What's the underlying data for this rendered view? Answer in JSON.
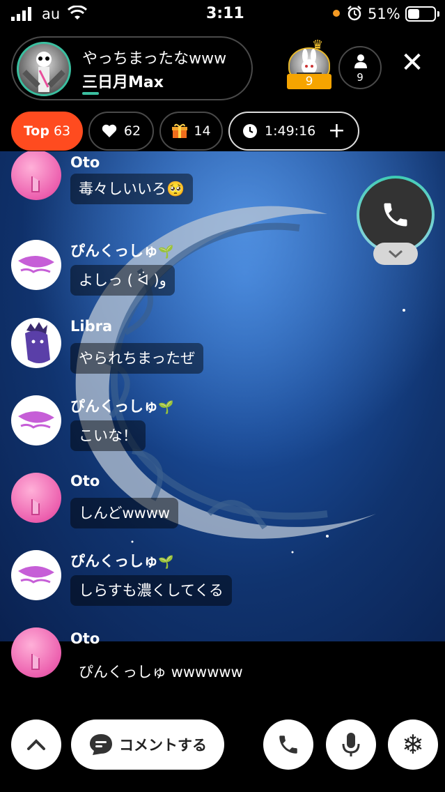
{
  "status_bar": {
    "carrier": "au",
    "time": "3:11",
    "battery_percent": "51%",
    "battery_level": 0.51
  },
  "header": {
    "stream_title": "やっちまったなwww",
    "host_name": "三日月Max",
    "top_ranker_badge": "9",
    "viewer_count": "9",
    "close_label": "✕"
  },
  "stats": {
    "top_label": "Top",
    "top_value": "63",
    "likes": "62",
    "gifts": "14",
    "elapsed": "1:49:16",
    "plus_label": "+"
  },
  "comments": [
    {
      "name": "Oto",
      "text": "毒々しいいろ🥺",
      "avatar": "pink-shush-avatar"
    },
    {
      "name": "ぴんくっしゅ",
      "sprout": "🌱",
      "text": "よしっ ( ᐛ )و",
      "avatar": "pink-scribble-avatar"
    },
    {
      "name": "Libra",
      "text": "やられちまったぜ",
      "avatar": "purple-character-avatar"
    },
    {
      "name": "ぴんくっしゅ",
      "sprout": "🌱",
      "text": "こいな！",
      "avatar": "pink-scribble-avatar"
    },
    {
      "name": "Oto",
      "text": "しんどwwww",
      "avatar": "pink-shush-avatar"
    },
    {
      "name": "ぴんくっしゅ",
      "sprout": "🌱",
      "text": "しらすも濃くしてくる",
      "avatar": "pink-scribble-avatar"
    },
    {
      "name": "Oto",
      "text": "ぴんくっしゅ wwwwww",
      "avatar": "pink-shush-avatar"
    }
  ],
  "bottom_bar": {
    "comment_label": "コメントする",
    "snow_glyph": "❄"
  },
  "colors": {
    "top_badge": "#ff4b1f",
    "accent_teal": "#3bbfa0",
    "rank_badge": "#f6a400",
    "stream_bg": "#1a4b98"
  }
}
